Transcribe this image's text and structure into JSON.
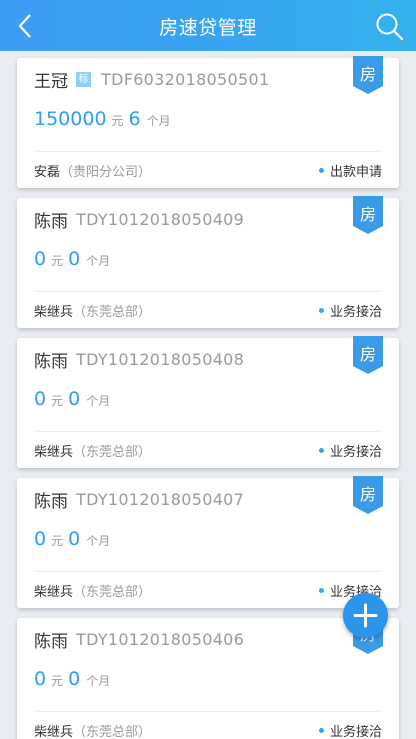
{
  "header": {
    "title": "房速贷管理"
  },
  "cards": [
    {
      "name": "王冠",
      "tag": "标",
      "code": "TDF6032018050501",
      "amount": "150000",
      "amount_unit": "元",
      "months": "6",
      "months_unit": "个月",
      "person": "安磊",
      "branch": "（贵阳分公司）",
      "status": "出款申请",
      "ribbon": "房"
    },
    {
      "name": "陈雨",
      "tag": "",
      "code": "TDY1012018050409",
      "amount": "0",
      "amount_unit": "元",
      "months": "0",
      "months_unit": "个月",
      "person": "柴继兵",
      "branch": "（东莞总部）",
      "status": "业务接洽",
      "ribbon": "房"
    },
    {
      "name": "陈雨",
      "tag": "",
      "code": "TDY1012018050408",
      "amount": "0",
      "amount_unit": "元",
      "months": "0",
      "months_unit": "个月",
      "person": "柴继兵",
      "branch": "（东莞总部）",
      "status": "业务接洽",
      "ribbon": "房"
    },
    {
      "name": "陈雨",
      "tag": "",
      "code": "TDY1012018050407",
      "amount": "0",
      "amount_unit": "元",
      "months": "0",
      "months_unit": "个月",
      "person": "柴继兵",
      "branch": "（东莞总部）",
      "status": "业务接洽",
      "ribbon": "房"
    },
    {
      "name": "陈雨",
      "tag": "",
      "code": "TDY1012018050406",
      "amount": "0",
      "amount_unit": "元",
      "months": "0",
      "months_unit": "个月",
      "person": "柴继兵",
      "branch": "（东莞总部）",
      "status": "业务接洽",
      "ribbon": "房"
    }
  ],
  "icons": {
    "back": "chevron-left-icon",
    "search": "search-icon",
    "add": "plus-icon"
  },
  "colors": {
    "header": "#3d9df3",
    "accent": "#2d9ff0",
    "ribbon": "#3a9ce8"
  }
}
